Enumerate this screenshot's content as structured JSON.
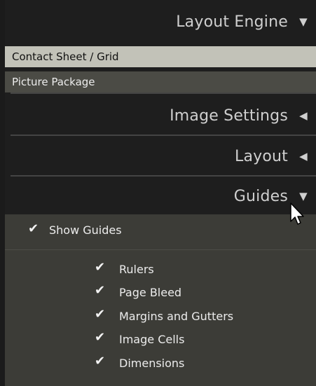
{
  "panels": {
    "layout_engine": {
      "title": "Layout Engine",
      "arrow": "▼"
    },
    "engine_items": [
      {
        "label": "Contact Sheet / Grid",
        "selected": true
      },
      {
        "label": "Picture Package",
        "selected": false
      }
    ],
    "image_settings": {
      "title": "Image Settings",
      "arrow": "◀"
    },
    "layout": {
      "title": "Layout",
      "arrow": "◀"
    },
    "guides": {
      "title": "Guides",
      "arrow": "▼"
    }
  },
  "guides": {
    "show_guides": {
      "label": "Show Guides",
      "checked": true
    },
    "options": [
      {
        "label": "Rulers",
        "checked": true
      },
      {
        "label": "Page Bleed",
        "checked": true
      },
      {
        "label": "Margins and Gutters",
        "checked": true
      },
      {
        "label": "Image Cells",
        "checked": true
      },
      {
        "label": "Dimensions",
        "checked": true
      }
    ],
    "checkmark": "✔"
  },
  "colors": {
    "panel_bg": "#1e1e1e",
    "selected_item_bg": "#c2c2b8",
    "item_bg": "#4b4b45",
    "guides_bg": "#3c3c37",
    "text": "#ececec"
  },
  "icons": {
    "cursor": "arrow-cursor-icon"
  }
}
